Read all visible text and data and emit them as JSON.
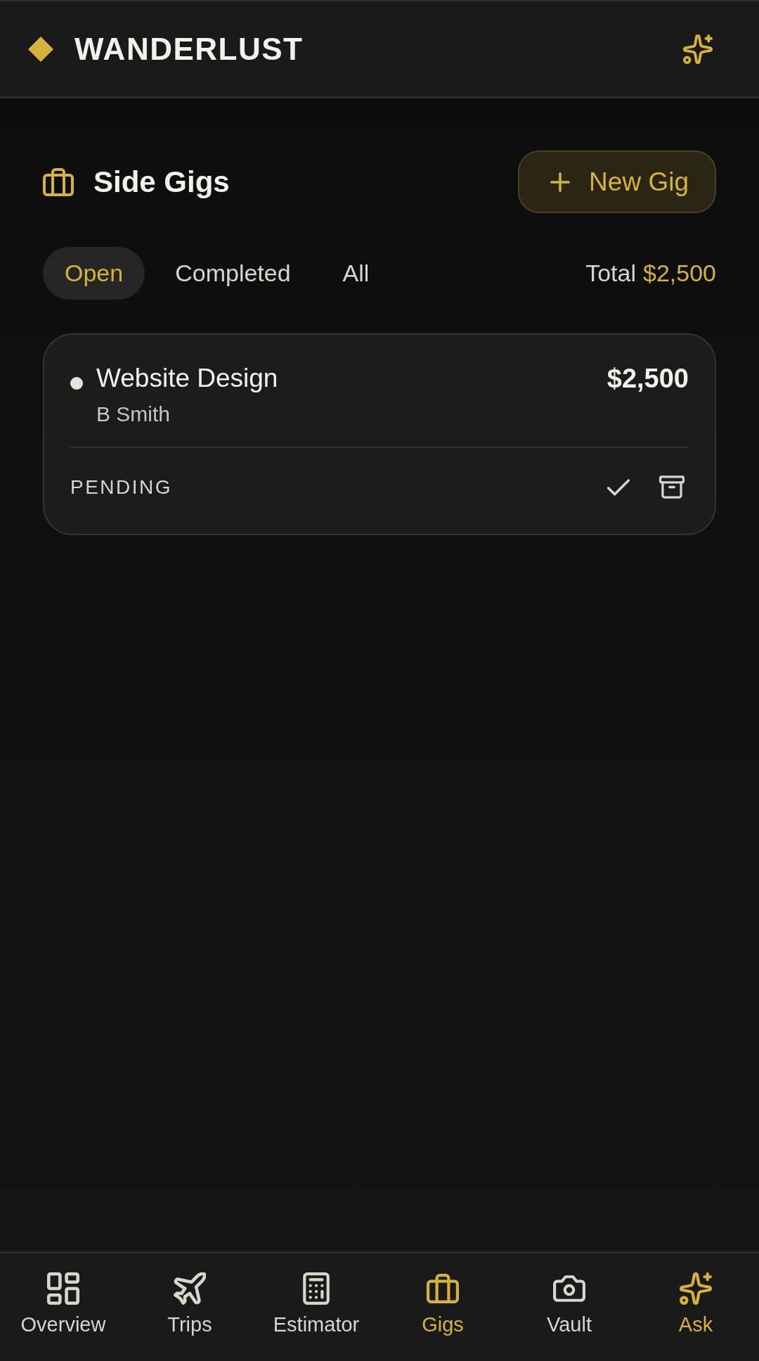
{
  "app_bar": {
    "title": "WANDERLUST"
  },
  "section": {
    "title": "Side Gigs",
    "new_button": "New Gig"
  },
  "filters": [
    {
      "label": "Open",
      "selected": true
    },
    {
      "label": "Completed",
      "selected": false
    },
    {
      "label": "All",
      "selected": false
    }
  ],
  "total": {
    "label": "Total",
    "amount": "$2,500"
  },
  "gigs": [
    {
      "title": "Website Design",
      "client": "B Smith",
      "amount": "$2,500",
      "status": "PENDING",
      "color": "#e6e2d8"
    }
  ],
  "bottom_nav": {
    "tabs": [
      {
        "label": "Overview",
        "selected": false
      },
      {
        "label": "Trips",
        "selected": false
      },
      {
        "label": "Estimator",
        "selected": false
      },
      {
        "label": "Gigs",
        "selected": true
      },
      {
        "label": "Vault",
        "selected": false
      }
    ],
    "ask_button": {
      "label": "Ask"
    }
  }
}
